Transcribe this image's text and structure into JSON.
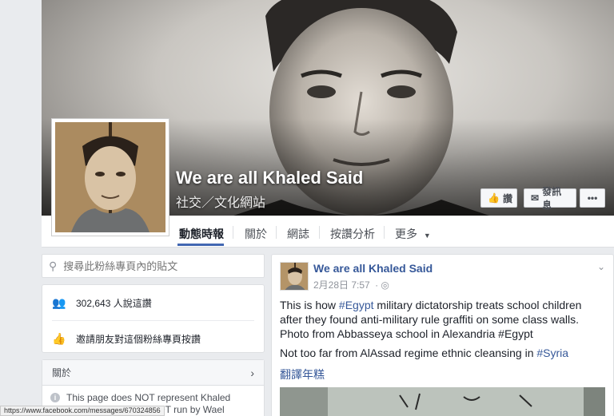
{
  "page": {
    "name": "We are all Khaled Said",
    "category": "社交／文化網站"
  },
  "cover_buttons": {
    "like": "讚",
    "message": "發訊息",
    "more": "•••"
  },
  "tabs": [
    {
      "label": "動態時報",
      "active": true
    },
    {
      "label": "關於"
    },
    {
      "label": "網誌"
    },
    {
      "label": "按讚分析"
    },
    {
      "label": "更多"
    }
  ],
  "sidebar": {
    "search_placeholder": "搜尋此粉絲專頁內的貼文",
    "likes_text": "302,643 人說這讚",
    "invite_text": "邀請朋友對這個粉絲專頁按讚",
    "about_title": "關於",
    "about_text": "This page does NOT represent Khaled Said's family and is NOT run by Wael Ghonim. It has"
  },
  "post": {
    "author": "We are all Khaled Said",
    "date": "2月28日 7:57",
    "paragraph1_before": "This is how ",
    "paragraph1_tag": "#Egypt",
    "paragraph1_after": " military dictatorship treats school children after they found anti-military rule graffiti on some class walls. Photo from Abbasseya school in Alexandria #Egypt",
    "paragraph2_before": "Not too far from AlAssad regime ethnic cleansing in ",
    "paragraph2_tag": "#Syria",
    "translate": "翻譯年糕"
  },
  "statusbar": {
    "url": "https://www.facebook.com/messages/670324856"
  },
  "colors": {
    "link": "#365899",
    "accent": "#4267b2"
  }
}
